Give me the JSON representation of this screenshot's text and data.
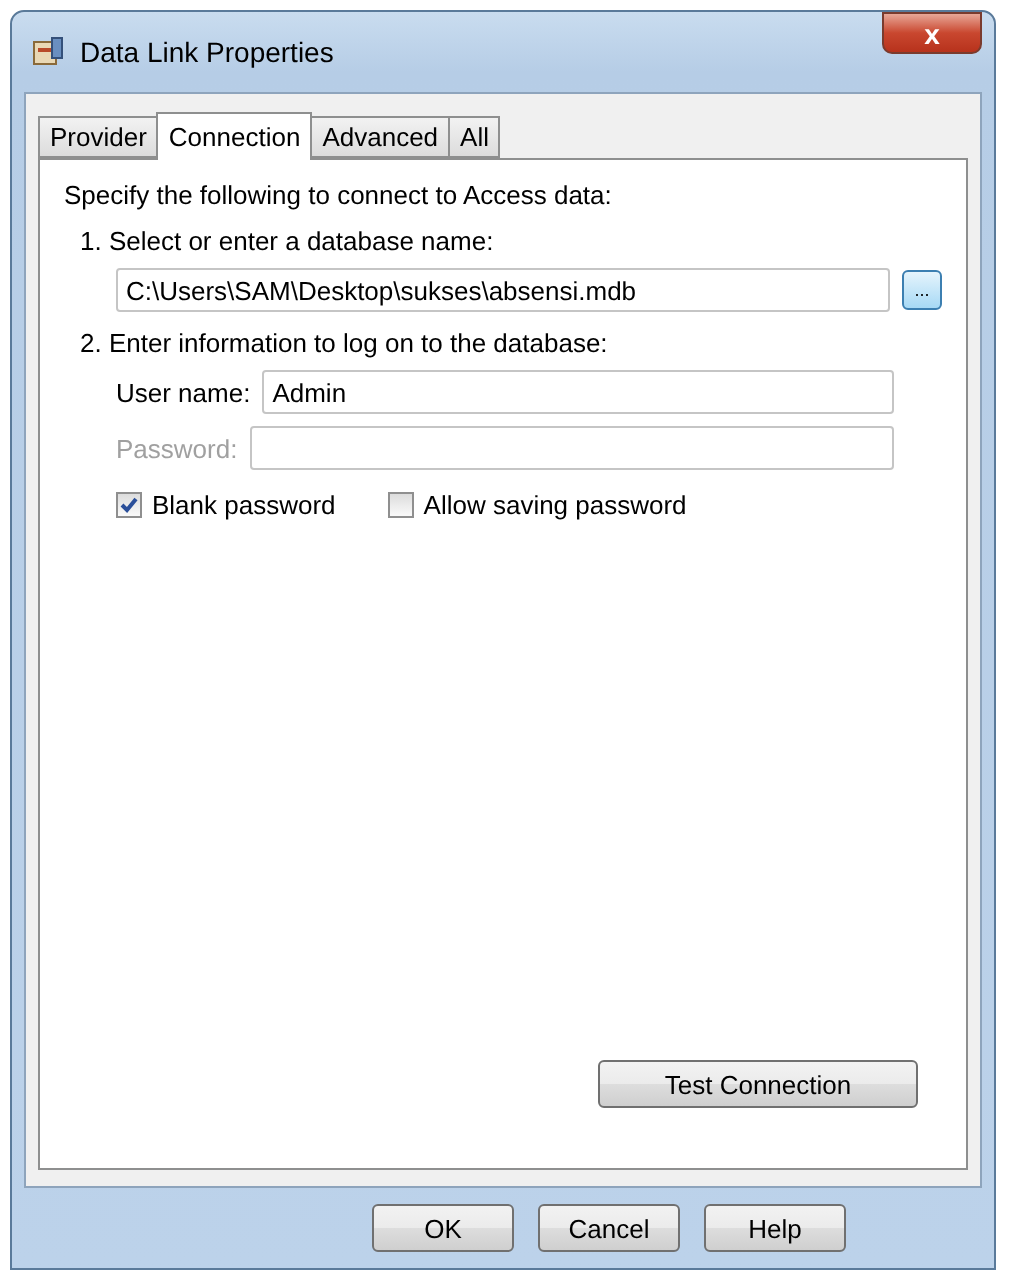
{
  "window": {
    "title": "Data Link Properties",
    "close": "x"
  },
  "tabs": [
    {
      "label": "Provider",
      "selected": false
    },
    {
      "label": "Connection",
      "selected": true
    },
    {
      "label": "Advanced",
      "selected": false
    },
    {
      "label": "All",
      "selected": false
    }
  ],
  "intro": "Specify the following to connect to Access data:",
  "step1": {
    "label": "1. Select or enter a database name:",
    "value": "C:\\Users\\SAM\\Desktop\\sukses\\absensi.mdb",
    "browse": "..."
  },
  "step2": {
    "label": "2. Enter information to log on to the database:",
    "fields": [
      {
        "label": "User name:",
        "value": "Admin",
        "disabled": false
      },
      {
        "label": "Password:",
        "disabled": true
      }
    ],
    "checks": [
      {
        "label": "Blank password",
        "checked": true
      },
      {
        "label": "Allow saving password",
        "checked": false
      }
    ]
  },
  "test_button": "Test Connection",
  "buttons": [
    "OK",
    "Cancel",
    "Help"
  ]
}
